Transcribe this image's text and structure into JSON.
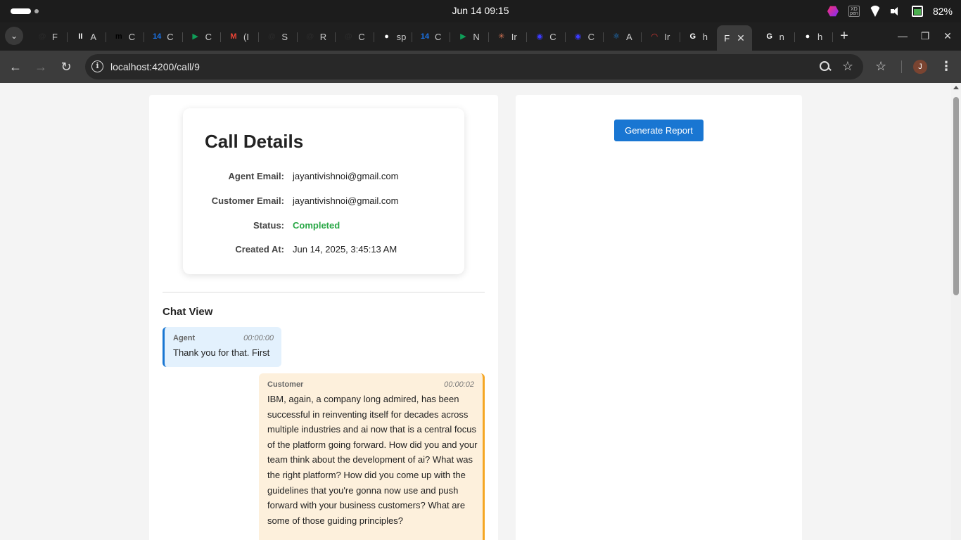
{
  "system": {
    "clock": "Jun 14  09:15",
    "battery": "82%"
  },
  "tabs": [
    {
      "fav": "@",
      "label": "F",
      "color": "#2a2a2a"
    },
    {
      "fav": "II",
      "label": "A",
      "color": "#ffffff"
    },
    {
      "fav": "m",
      "label": "C",
      "color": "#000000"
    },
    {
      "fav": "14",
      "label": "C",
      "color": "#1a73e8"
    },
    {
      "fav": "▶",
      "label": "C",
      "color": "#0f9d58"
    },
    {
      "fav": "M",
      "label": "(I",
      "color": "#ea4335"
    },
    {
      "fav": "@",
      "label": "S",
      "color": "#2a2a2a"
    },
    {
      "fav": "@",
      "label": "R",
      "color": "#2a2a2a"
    },
    {
      "fav": "@",
      "label": "C",
      "color": "#2a2a2a"
    },
    {
      "fav": "●",
      "label": "sp",
      "color": "#ffffff"
    },
    {
      "fav": "14",
      "label": "C",
      "color": "#1a73e8"
    },
    {
      "fav": "▶",
      "label": "N",
      "color": "#0f9d58"
    },
    {
      "fav": "✳",
      "label": "Ir",
      "color": "#d97757"
    },
    {
      "fav": "◉",
      "label": "C",
      "color": "#3b3bff"
    },
    {
      "fav": "◉",
      "label": "C",
      "color": "#3b3bff"
    },
    {
      "fav": "⚛",
      "label": "A",
      "color": "#1e88e5"
    },
    {
      "fav": "◠",
      "label": "Ir",
      "color": "#e53935"
    },
    {
      "fav": "G",
      "label": "h",
      "color": "#ffffff"
    }
  ],
  "active_tab": {
    "label": "F",
    "close": "✕"
  },
  "tabs_after": [
    {
      "fav": "G",
      "label": "n",
      "color": "#ffffff"
    },
    {
      "fav": "●",
      "label": "h",
      "color": "#ffffff"
    }
  ],
  "toolbar": {
    "url": "localhost:4200/call/9",
    "avatar_initial": "J"
  },
  "call_details": {
    "title": "Call Details",
    "fields": [
      {
        "label": "Agent Email:",
        "value": "jayantivishnoi@gmail.com"
      },
      {
        "label": "Customer Email:",
        "value": "jayantivishnoi@gmail.com"
      },
      {
        "label": "Status:",
        "value": "Completed"
      },
      {
        "label": "Created At:",
        "value": "Jun 14, 2025, 3:45:13 AM"
      }
    ],
    "status_color": "#28a745"
  },
  "chat": {
    "title": "Chat View",
    "messages": [
      {
        "speaker": "Agent",
        "time": "00:00:00",
        "text": "Thank you for that. First"
      },
      {
        "speaker": "Customer",
        "time": "00:00:02",
        "text": "IBM, again, a company long admired, has been successful in reinventing itself for decades across multiple industries and ai now that is a central focus of the platform going forward. How did you and your team think about the development of ai? What was the right platform? How did you come up with the guidelines that you're gonna now use and push forward with your business customers? What are some of those guiding principles?"
      }
    ]
  },
  "report": {
    "button_label": "Generate Report",
    "accent": "#1976d2"
  }
}
